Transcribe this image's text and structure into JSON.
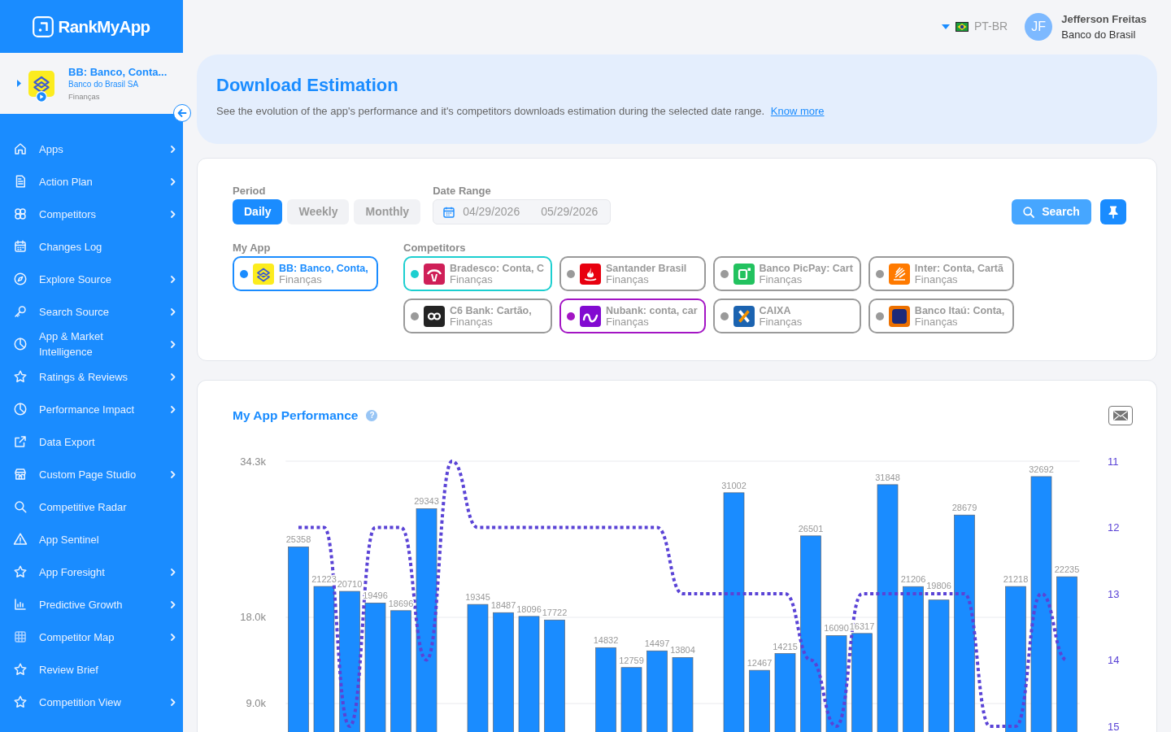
{
  "sidebar": {
    "logo": "RankMyApp",
    "app": {
      "name": "BB: Banco, Conta...",
      "developer": "Banco do Brasil SA",
      "category": "Finanças"
    },
    "items": [
      {
        "label": "Apps",
        "submenu": true
      },
      {
        "label": "Action Plan",
        "submenu": true
      },
      {
        "label": "Competitors",
        "submenu": true
      },
      {
        "label": "Changes Log",
        "submenu": false
      },
      {
        "label": "Explore Source",
        "submenu": true
      },
      {
        "label": "Search Source",
        "submenu": true
      },
      {
        "label": "App & Market Intelligence",
        "submenu": true
      },
      {
        "label": "Ratings & Reviews",
        "submenu": true
      },
      {
        "label": "Performance Impact",
        "submenu": true
      },
      {
        "label": "Data Export",
        "submenu": false
      },
      {
        "label": "Custom Page Studio",
        "submenu": true
      },
      {
        "label": "Competitive Radar",
        "submenu": false
      },
      {
        "label": "App Sentinel",
        "submenu": false
      },
      {
        "label": "App Foresight",
        "submenu": true
      },
      {
        "label": "Predictive Growth",
        "submenu": true
      },
      {
        "label": "Competitor Map",
        "submenu": true
      },
      {
        "label": "Review Brief",
        "submenu": false
      },
      {
        "label": "Competition View",
        "submenu": true
      }
    ]
  },
  "top_bar": {
    "language": "PT-BR",
    "user": {
      "initials": "JF",
      "name": "Jefferson Freitas",
      "organization": "Banco do Brasil"
    }
  },
  "header": {
    "title": "Download Estimation",
    "description": "See the evolution of the app's performance and it's competitors downloads estimation during the selected date range.",
    "link": "Know more"
  },
  "filters": {
    "period": {
      "label": "Period",
      "options": [
        {
          "label": "Daily",
          "selected": true
        },
        {
          "label": "Weekly",
          "selected": false
        },
        {
          "label": "Monthly",
          "selected": false
        }
      ]
    },
    "date_range": {
      "label": "Date Range",
      "start": "04/29/2026",
      "end": "05/29/2026"
    },
    "search_button": "Search",
    "my_app": {
      "label": "My App",
      "app": {
        "name": "BB: Banco, Conta,",
        "category": "Finanças",
        "color": "#1a8cff"
      }
    },
    "competitors": {
      "label": "Competitors",
      "items": [
        {
          "name": "Bradesco: Conta, C",
          "category": "Finanças",
          "selected": true,
          "color": "#1ccfd0"
        },
        {
          "name": "Santander Brasil",
          "category": "Finanças",
          "selected": false
        },
        {
          "name": "Banco PicPay: Cart",
          "category": "Finanças",
          "selected": false
        },
        {
          "name": "Inter: Conta, Cartã",
          "category": "Finanças",
          "selected": false
        },
        {
          "name": "C6 Bank: Cartão,",
          "category": "Finanças",
          "selected": false
        },
        {
          "name": "Nubank: conta, car",
          "category": "Finanças",
          "selected": true,
          "color": "#a315c4"
        },
        {
          "name": "CAIXA",
          "category": "Finanças",
          "selected": false
        },
        {
          "name": "Banco Itaú: Conta,",
          "category": "Finanças",
          "selected": false
        }
      ]
    }
  },
  "performance": {
    "title": "My App Performance",
    "help": "?",
    "chart_data": {
      "type": "bar",
      "series": [
        {
          "color": "#1a8cff",
          "values": [
            25358,
            21223,
            20710,
            19496,
            18696,
            29343,
            null,
            19345,
            18487,
            18096,
            17722,
            null,
            14832,
            12759,
            14497,
            13804,
            null,
            31002,
            12467,
            14215,
            26501,
            16090,
            16317,
            31848,
            21206,
            19806,
            28679,
            null,
            21218,
            32692,
            22235
          ],
          "value_labels": [
            "25358",
            "21223",
            "20710",
            "19496",
            "18696",
            "29343",
            null,
            "19345",
            "18487",
            "18096",
            "17722",
            null,
            "14832",
            "12759",
            "14497",
            "13804",
            null,
            "31002",
            "12467",
            "14215",
            "26501",
            "16090",
            "16317",
            "31848",
            "21206",
            "19806",
            "28679",
            null,
            "21218",
            "32692",
            "22235"
          ]
        },
        {
          "type": "line",
          "axis": "y2",
          "line_style": "dotted",
          "color": "#5a43d6",
          "values": [
            12,
            12,
            15,
            12,
            12,
            14,
            11,
            12,
            12,
            12,
            12,
            12,
            12,
            12,
            12,
            13,
            13,
            13,
            13,
            13,
            14,
            15,
            13,
            13,
            13,
            13,
            13,
            15,
            15,
            13,
            14
          ]
        }
      ],
      "ylim": [
        0,
        34300
      ],
      "yticks": [
        {
          "value": 34300,
          "label": "34.3k"
        },
        {
          "value": 18000,
          "label": "18.0k"
        },
        {
          "value": 9000,
          "label": "9.0k"
        }
      ],
      "y2lim": [
        15,
        11
      ],
      "y2ticks": [
        11,
        12,
        13,
        14,
        15
      ]
    }
  }
}
